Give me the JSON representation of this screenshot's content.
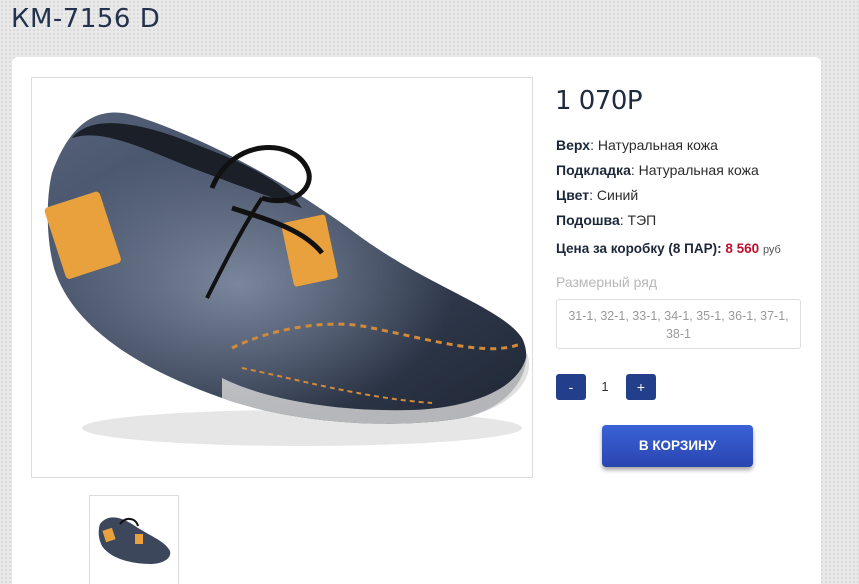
{
  "product": {
    "title": "КМ-7156 D",
    "price": "1 070Р",
    "specs": [
      {
        "label": "Верх",
        "value": ": Натуральная кожа"
      },
      {
        "label": "Подкладка",
        "value": ": Натуральная кожа"
      },
      {
        "label": "Цвет",
        "value": ": Синий"
      },
      {
        "label": "Подошва",
        "value": ": ТЭП"
      }
    ],
    "box_price_label": "Цена за коробку (8 ПАР): ",
    "box_price_value": "8 560",
    "box_price_currency": "руб",
    "size_range_label": "Размерный ряд",
    "size_range": "31-1, 32-1, 33-1, 34-1, 35-1, 36-1, 37-1, 38-1",
    "image": "navy-leather-moccasin-shoe"
  },
  "quantity": {
    "minus_label": "-",
    "value": "1",
    "plus_label": "+"
  },
  "cart": {
    "button_label": "В КОРЗИНУ"
  },
  "colors": {
    "accent": "#233f8c",
    "price_red": "#c0102b",
    "title": "#23324d"
  }
}
